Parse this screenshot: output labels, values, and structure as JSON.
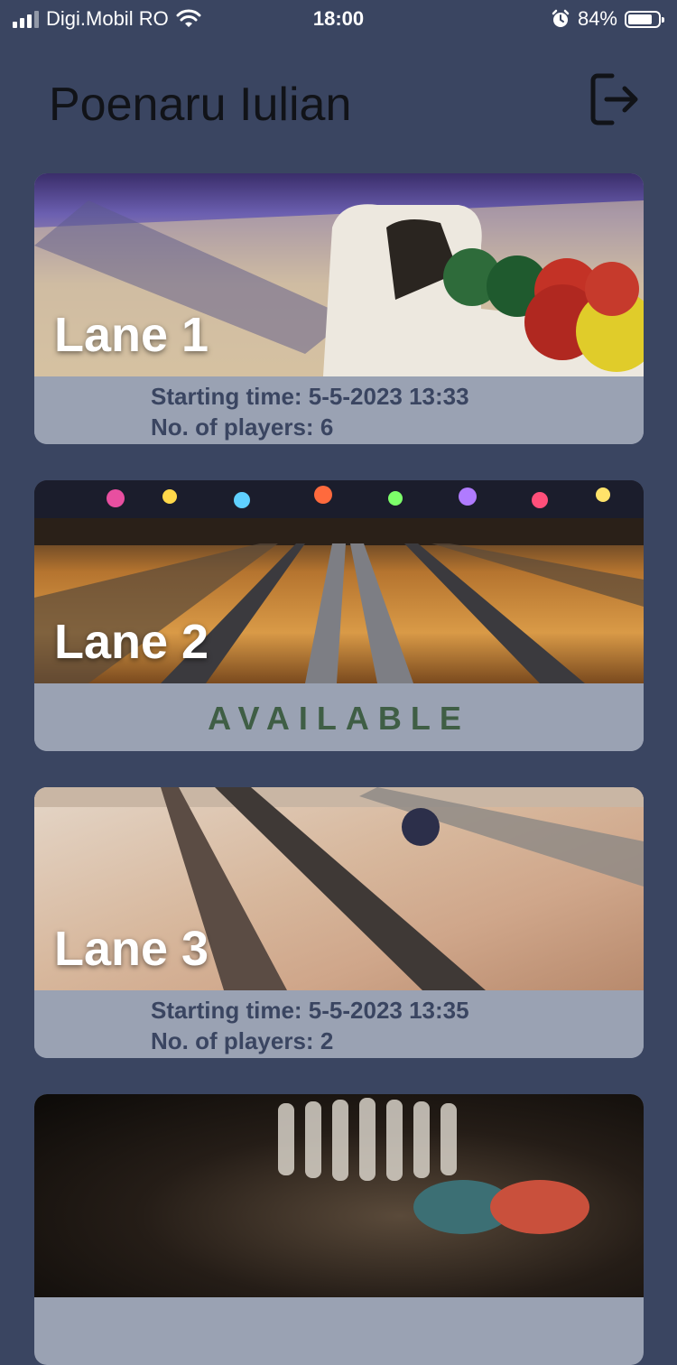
{
  "status_bar": {
    "carrier": "Digi.Mobil RO",
    "time": "18:00",
    "battery_percent": "84%",
    "battery_level": 0.84,
    "icons": [
      "signal-icon",
      "wifi-icon",
      "alarm-icon",
      "battery-icon"
    ]
  },
  "header": {
    "title": "Poenaru Iulian",
    "logout_icon": "logout-icon"
  },
  "lanes": [
    {
      "name": "Lane 1",
      "status": "occupied",
      "starting_time_label": "Starting time: 5-5-2023 13:33",
      "players_label": "No. of players: 6"
    },
    {
      "name": "Lane 2",
      "status": "available",
      "available_label": "AVAILABLE"
    },
    {
      "name": "Lane 3",
      "status": "occupied",
      "starting_time_label": "Starting time: 5-5-2023 13:35",
      "players_label": "No. of players: 2"
    },
    {
      "name": "",
      "status": "partially-visible"
    }
  ],
  "colors": {
    "background": "#3a4561",
    "card_footer": "#9aa2b3",
    "info_text": "#3a4561",
    "available_text": "#3f5e45",
    "title_text": "#111318"
  }
}
